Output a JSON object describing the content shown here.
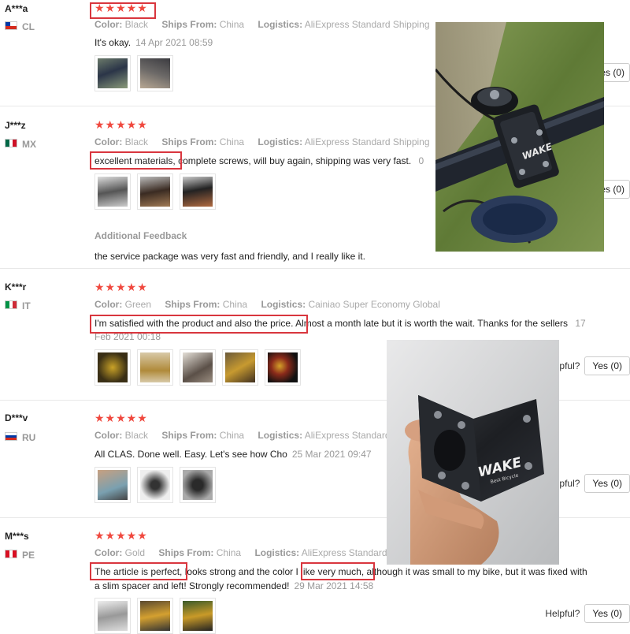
{
  "labels": {
    "color": "Color:",
    "ships_from": "Ships From:",
    "logistics": "Logistics:",
    "helpful": "Helpful?",
    "yes": "Yes (0)",
    "additional_feedback": "Additional Feedback"
  },
  "stars_text": "★★★★★",
  "reviews": [
    {
      "user": "A***a",
      "country": "CL",
      "color": "Black",
      "ships_from": "China",
      "logistics": "AliExpress Standard Shipping",
      "text": "It's okay.",
      "date": "14 Apr 2021 08:59",
      "helpful": "es (0)"
    },
    {
      "user": "J***z",
      "country": "MX",
      "color": "Black",
      "ships_from": "China",
      "logistics": "AliExpress Standard Shipping",
      "text_highlight": "excellent materials,",
      "text_rest": "complete screws, will buy again, shipping was very fast.",
      "date_fragment": "0",
      "helpful": "es (0)",
      "additional_feedback_text": "the service package was very fast and friendly, and I really like it."
    },
    {
      "user": "K***r",
      "country": "IT",
      "color": "Green",
      "ships_from": "China",
      "logistics": "Cainiao Super Economy Global",
      "text_highlight": "I'm satisfied with the product and also the price.",
      "text_rest": "Almost a month late but it is worth the wait. Thanks for the sellers",
      "date_part1": "17",
      "date_part2": "Feb 2021 00:18",
      "helpful": "lpful?"
    },
    {
      "user": "D***v",
      "country": "RU",
      "color": "Black",
      "ships_from": "China",
      "logistics": "AliExpress Standard S",
      "text": "All CLAS. Done well. Easy. Let's see how Cho",
      "date": "25 Mar 2021 09:47",
      "helpful": "lpful?"
    },
    {
      "user": "M***s",
      "country": "PE",
      "color": "Gold",
      "ships_from": "China",
      "logistics": "AliExpress Standard S",
      "text_highlight1": "The article is perfect,",
      "text_mid": "looks strong and the color",
      "text_highlight2": "I like very much,",
      "text_rest": "although it was small to my bike, but it was fixed with",
      "text_line2": "a slim spacer and left! Strongly recommended!",
      "date": "29 Mar 2021 14:58",
      "helpful": "Helpful?"
    }
  ],
  "overlay_photos": {
    "photo1_brand": "WAKE",
    "photo2_brand": "WAKE",
    "photo2_sub": "Best Bicycle"
  },
  "colors": {
    "star_red": "#f0483e",
    "highlight_red": "#d9363e"
  }
}
